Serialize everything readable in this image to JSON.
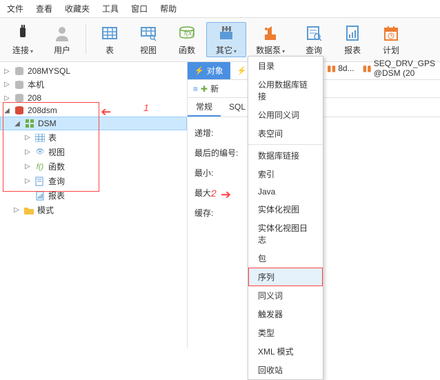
{
  "menubar": [
    "文件",
    "查看",
    "收藏夹",
    "工具",
    "窗口",
    "帮助"
  ],
  "toolbar": [
    {
      "label": "连接",
      "color": "#333"
    },
    {
      "label": "用户",
      "color": "#888"
    },
    {
      "label": "表",
      "color": "#5b9bd5"
    },
    {
      "label": "视图",
      "color": "#5b9bd5"
    },
    {
      "label": "函数",
      "color": "#70ad47"
    },
    {
      "label": "其它",
      "color": "#5b9bd5",
      "active": true
    },
    {
      "label": "数据泵",
      "color": "#ed7d31"
    },
    {
      "label": "查询",
      "color": "#5b9bd5"
    },
    {
      "label": "报表",
      "color": "#5b9bd5"
    },
    {
      "label": "计划",
      "color": "#ed7d31"
    }
  ],
  "tree": [
    {
      "level": 0,
      "toggle": "▷",
      "icon": "db-gray",
      "label": "208MYSQL"
    },
    {
      "level": 0,
      "toggle": "▷",
      "icon": "db-gray",
      "label": "本机"
    },
    {
      "level": 0,
      "toggle": "▷",
      "icon": "db-gray",
      "label": "208"
    },
    {
      "level": 0,
      "toggle": "◢",
      "icon": "db-red",
      "label": "208dsm"
    },
    {
      "level": 1,
      "toggle": "◢",
      "icon": "schema",
      "label": "DSM",
      "selected": true
    },
    {
      "level": 2,
      "toggle": "▷",
      "icon": "table",
      "label": "表"
    },
    {
      "level": 2,
      "toggle": "▷",
      "icon": "view",
      "label": "视图"
    },
    {
      "level": 2,
      "toggle": "▷",
      "icon": "fx",
      "label": "函数"
    },
    {
      "level": 2,
      "toggle": "▷",
      "icon": "query",
      "label": "查询"
    },
    {
      "level": 2,
      "toggle": "",
      "icon": "report",
      "label": "报表"
    },
    {
      "level": 1,
      "toggle": "▷",
      "icon": "folder",
      "label": "模式"
    }
  ],
  "annotations": {
    "label1": "1",
    "label2": "2"
  },
  "tabs": {
    "obj": "对象",
    "star": ""
  },
  "actions": {
    "new": "新"
  },
  "subtabs": {
    "general": "常规",
    "sql": "SQL 预"
  },
  "form": [
    {
      "label": "递增:"
    },
    {
      "label": "最后的编号:"
    },
    {
      "label": "最小:"
    },
    {
      "label": "最大:"
    },
    {
      "label": "缓存:"
    }
  ],
  "menu": {
    "group1": [
      "目录",
      "公用数据库链接",
      "公用同义词",
      "表空间"
    ],
    "group2": [
      "数据库链接",
      "索引",
      "Java",
      "实体化视图",
      "实体化视图日志",
      "包",
      "序列",
      "同义词",
      "触发器",
      "类型",
      "XML 模式",
      "回收站"
    ],
    "highlight": "序列"
  },
  "right_tabs": {
    "t1": "8d...",
    "t2": "SEQ_DRV_GPS @DSM (20"
  }
}
